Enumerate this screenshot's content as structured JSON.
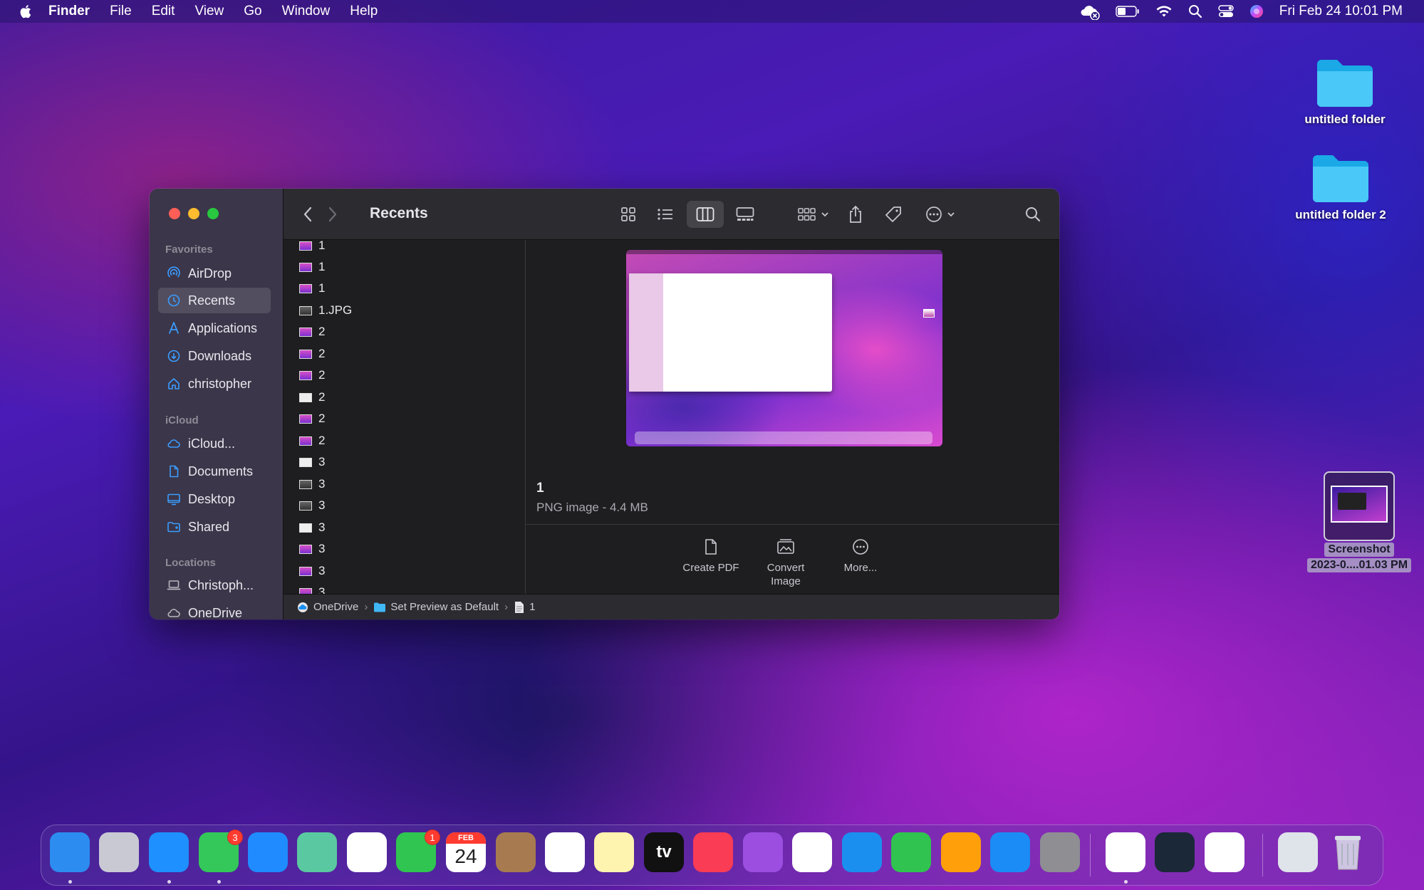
{
  "menubar": {
    "app_name": "Finder",
    "menus": [
      "File",
      "Edit",
      "View",
      "Go",
      "Window",
      "Help"
    ],
    "clock": "Fri Feb 24  10:01 PM"
  },
  "desktop": {
    "icons": [
      {
        "label": "untitled folder"
      },
      {
        "label": "untitled folder 2"
      },
      {
        "label_line1": "Screenshot",
        "label_line2": "2023-0....01.03 PM"
      }
    ]
  },
  "finder": {
    "title": "Recents",
    "sidebar": {
      "favorites_header": "Favorites",
      "favorites": [
        {
          "label": "AirDrop",
          "icon": "airdrop-icon"
        },
        {
          "label": "Recents",
          "icon": "clock-icon",
          "selected": true
        },
        {
          "label": "Applications",
          "icon": "applications-icon"
        },
        {
          "label": "Downloads",
          "icon": "download-icon"
        },
        {
          "label": "christopher",
          "icon": "home-icon"
        }
      ],
      "icloud_header": "iCloud",
      "icloud": [
        {
          "label": "iCloud...",
          "icon": "cloud-icon"
        },
        {
          "label": "Documents",
          "icon": "document-icon"
        },
        {
          "label": "Desktop",
          "icon": "desktop-icon"
        },
        {
          "label": "Shared",
          "icon": "shared-folder-icon"
        }
      ],
      "locations_header": "Locations",
      "locations": [
        {
          "label": "Christoph...",
          "icon": "laptop-icon"
        },
        {
          "label": "OneDrive",
          "icon": "cloud-icon"
        }
      ]
    },
    "files": [
      "1",
      "1",
      "1",
      "1.JPG",
      "2",
      "2",
      "2",
      "2",
      "2",
      "2",
      "3",
      "3",
      "3",
      "3",
      "3",
      "3",
      "3"
    ],
    "preview": {
      "name": "1",
      "kind": "PNG image - 4.4 MB",
      "actions": [
        {
          "label": "Create PDF",
          "icon": "create-pdf-icon"
        },
        {
          "label_line1": "Convert",
          "label_line2": "Image",
          "icon": "convert-image-icon"
        },
        {
          "label": "More...",
          "icon": "more-icon"
        }
      ]
    },
    "pathbar": [
      "OneDrive",
      "Set Preview as Default",
      "1"
    ]
  },
  "dock": {
    "apps": [
      {
        "name": "Finder",
        "color": "#2d8cf0"
      },
      {
        "name": "Launchpad",
        "color": "#c9c9d4"
      },
      {
        "name": "Safari",
        "color": "#1e90ff"
      },
      {
        "name": "Messages",
        "color": "#34c759",
        "badge": "3"
      },
      {
        "name": "Mail",
        "color": "#1f8bff"
      },
      {
        "name": "Maps",
        "color": "#5ac8a0"
      },
      {
        "name": "Photos",
        "color": "#ffffff"
      },
      {
        "name": "FaceTime",
        "color": "#30c450",
        "badge": "1"
      },
      {
        "name": "Calendar",
        "color": "#ffffff",
        "month": "FEB",
        "day": "24"
      },
      {
        "name": "Contacts",
        "color": "#a77b4f"
      },
      {
        "name": "Reminders",
        "color": "#ffffff"
      },
      {
        "name": "Notes",
        "color": "#fff3b0"
      },
      {
        "name": "TV",
        "color": "#111111",
        "text": "tv"
      },
      {
        "name": "Music",
        "color": "#fa3c55"
      },
      {
        "name": "Podcasts",
        "color": "#9b4ee0"
      },
      {
        "name": "News",
        "color": "#ffffff"
      },
      {
        "name": "Keynote",
        "color": "#1a8ff0"
      },
      {
        "name": "Numbers",
        "color": "#30c34f"
      },
      {
        "name": "Pages",
        "color": "#ff9f0a"
      },
      {
        "name": "App Store",
        "color": "#1b8cf5"
      },
      {
        "name": "System Preferences",
        "color": "#8e8e93"
      },
      {
        "name": "Chrome",
        "color": "#ffffff"
      },
      {
        "name": "Steam",
        "color": "#1b2838"
      },
      {
        "name": "OneDrive",
        "color": "#ffffff"
      },
      {
        "name": "Screenshot",
        "color": "#dfe3ea"
      },
      {
        "name": "Trash",
        "color": "transparent"
      }
    ]
  }
}
